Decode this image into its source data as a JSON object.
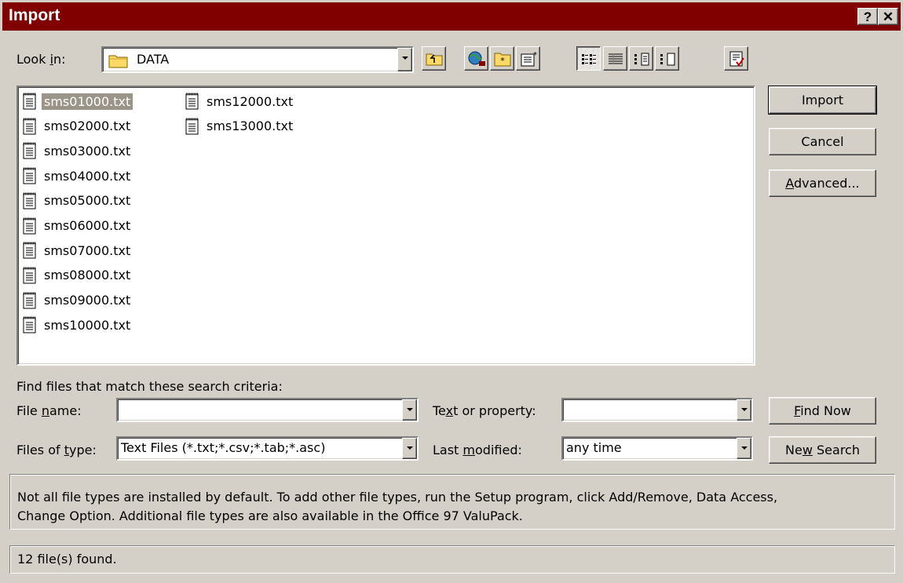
{
  "window": {
    "title": "Import",
    "help_glyph": "?",
    "close_glyph": "✕"
  },
  "lookin": {
    "label_pre": "Look ",
    "label_key": "i",
    "label_post": "n:",
    "value": "DATA"
  },
  "toolbar": {
    "icons": [
      "up-one-level-icon",
      "search-web-icon",
      "favorites-icon",
      "add-favorites-icon",
      "list-view-icon",
      "details-view-icon",
      "properties-view-icon",
      "preview-view-icon",
      "commands-icon"
    ]
  },
  "files": [
    "sms01000.txt",
    "sms02000.txt",
    "sms03000.txt",
    "sms04000.txt",
    "sms05000.txt",
    "sms06000.txt",
    "sms07000.txt",
    "sms08000.txt",
    "sms09000.txt",
    "sms10000.txt",
    "sms12000.txt",
    "sms13000.txt"
  ],
  "selected_file": "sms01000.txt",
  "buttons": {
    "import": "Import",
    "cancel": "Cancel",
    "advanced_key": "A",
    "advanced_rest": "dvanced...",
    "find_now_key": "F",
    "find_now_rest": "ind Now",
    "new_search_pre": "Ne",
    "new_search_key": "w",
    "new_search_post": " Search"
  },
  "search": {
    "heading": "Find files that match these search criteria:",
    "filename_pre": "File ",
    "filename_key": "n",
    "filename_post": "ame:",
    "filename_value": "",
    "filetype_pre": "Files of ",
    "filetype_key": "t",
    "filetype_post": "ype:",
    "filetype_value": "Text Files (*.txt;*.csv;*.tab;*.asc)",
    "textprop_pre": "Te",
    "textprop_key": "x",
    "textprop_post": "t or property:",
    "textprop_value": "",
    "lastmod_pre": "Last ",
    "lastmod_key": "m",
    "lastmod_post": "odified:",
    "lastmod_value": "any time"
  },
  "info": {
    "line1": "Not all file types are installed by default.  To add other file types, run the Setup program, click Add/Remove, Data Access,",
    "line2": "Change Option.  Additional file types are also available in the Office 97 ValuPack."
  },
  "status": "12 file(s) found."
}
